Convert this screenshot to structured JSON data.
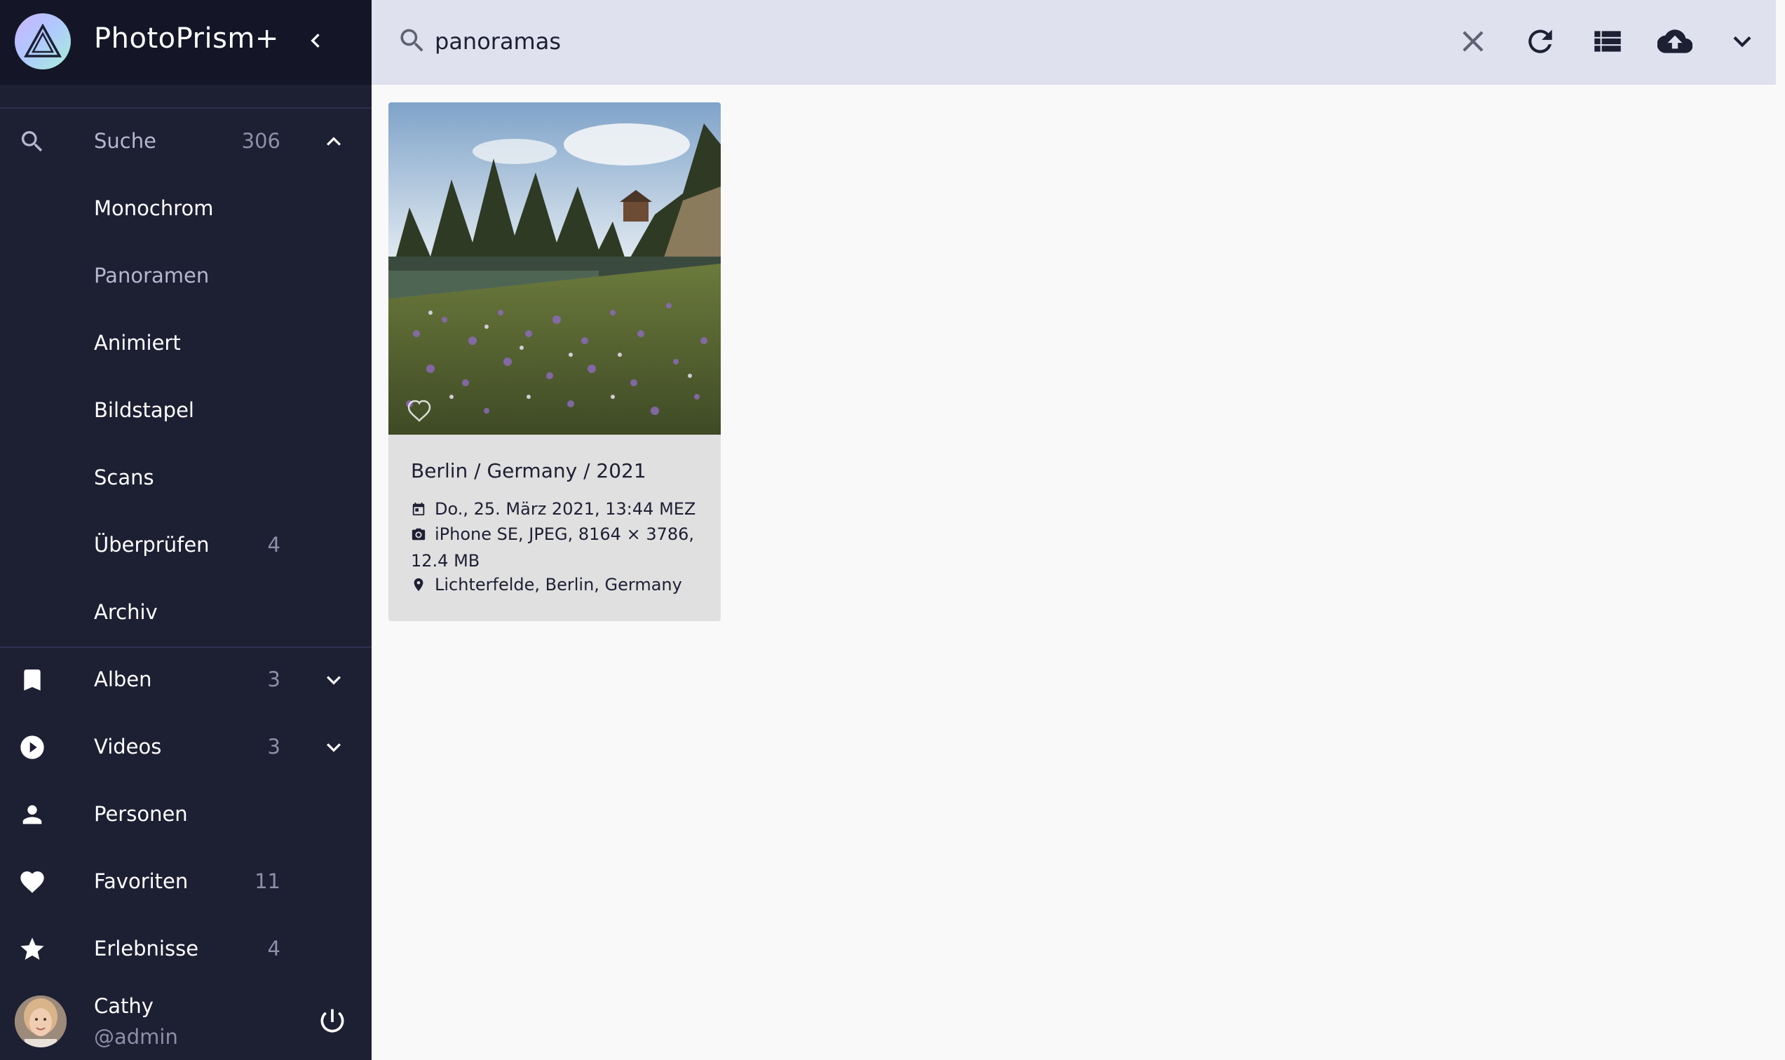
{
  "app": {
    "title": "PhotoPrism+"
  },
  "search": {
    "value": "panoramas",
    "placeholder": ""
  },
  "sidebar": {
    "search": {
      "label": "Suche",
      "count": "306"
    },
    "sub_items": [
      {
        "label": "Monochrom",
        "count": ""
      },
      {
        "label": "Panoramen",
        "count": ""
      },
      {
        "label": "Animiert",
        "count": ""
      },
      {
        "label": "Bildstapel",
        "count": ""
      },
      {
        "label": "Scans",
        "count": ""
      },
      {
        "label": "Überprüfen",
        "count": "4"
      },
      {
        "label": "Archiv",
        "count": ""
      }
    ],
    "items": [
      {
        "label": "Alben",
        "count": "3",
        "icon": "bookmark-icon"
      },
      {
        "label": "Videos",
        "count": "3",
        "icon": "play-circle-icon"
      },
      {
        "label": "Personen",
        "count": "",
        "icon": "person-icon"
      },
      {
        "label": "Favoriten",
        "count": "11",
        "icon": "heart-icon"
      },
      {
        "label": "Erlebnisse",
        "count": "4",
        "icon": "star-icon"
      }
    ],
    "user": {
      "name": "Cathy",
      "handle": "@admin"
    }
  },
  "results": [
    {
      "title": "Berlin / Germany / 2021",
      "date": "Do., 25. März 2021, 13:44 MEZ",
      "camera_line1": "iPhone SE, JPEG, 8164 × 3786,",
      "camera_line2": "12.4 MB",
      "location": "Lichterfelde, Berlin, Germany"
    }
  ],
  "colors": {
    "sidebar_bg": "#1d1f33",
    "topbar_bg": "#dfe1ee",
    "active_item": "#b3b8d0"
  }
}
